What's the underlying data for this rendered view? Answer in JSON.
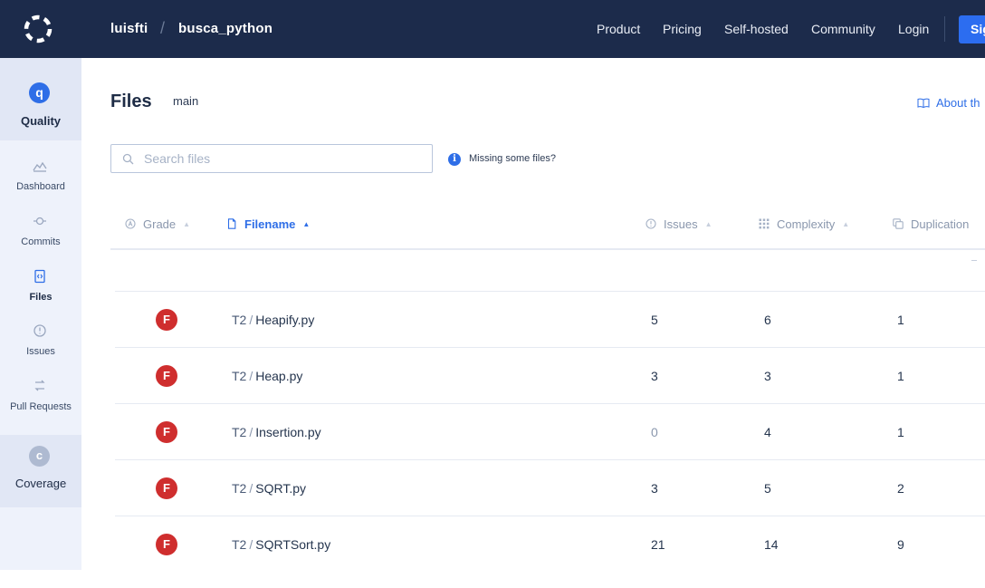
{
  "header": {
    "owner": "luisfti",
    "separator": "/",
    "repo": "busca_python",
    "nav": {
      "product": "Product",
      "pricing": "Pricing",
      "self_hosted": "Self-hosted",
      "community": "Community",
      "login": "Login"
    },
    "signup_label": "Sign"
  },
  "sidebar": {
    "quality": {
      "badge": "q",
      "label": "Quality"
    },
    "items": [
      {
        "label": "Dashboard",
        "icon": "dashboard-icon"
      },
      {
        "label": "Commits",
        "icon": "commits-icon"
      },
      {
        "label": "Files",
        "icon": "files-icon",
        "active": true
      },
      {
        "label": "Issues",
        "icon": "issues-icon"
      },
      {
        "label": "Pull Requests",
        "icon": "pull-requests-icon"
      }
    ],
    "coverage": {
      "badge": "c",
      "label": "Coverage"
    }
  },
  "main": {
    "title": "Files",
    "branch": "main",
    "about_link": "About th",
    "search": {
      "placeholder": "Search files",
      "value": ""
    },
    "missing_files_link": "Missing some files?",
    "columns": {
      "grade": "Grade",
      "filename": "Filename",
      "issues": "Issues",
      "complexity": "Complexity",
      "duplication": "Duplication"
    },
    "rows": [
      {
        "grade": "F",
        "dir": "T2",
        "file": "Heapify.py",
        "issues": "5",
        "complexity": "6",
        "duplication": "1"
      },
      {
        "grade": "F",
        "dir": "T2",
        "file": "Heap.py",
        "issues": "3",
        "complexity": "3",
        "duplication": "1"
      },
      {
        "grade": "F",
        "dir": "T2",
        "file": "Insertion.py",
        "issues": "0",
        "complexity": "4",
        "duplication": "1"
      },
      {
        "grade": "F",
        "dir": "T2",
        "file": "SQRT.py",
        "issues": "3",
        "complexity": "5",
        "duplication": "2"
      },
      {
        "grade": "F",
        "dir": "T2",
        "file": "SQRTSort.py",
        "issues": "21",
        "complexity": "14",
        "duplication": "9"
      }
    ]
  },
  "colors": {
    "topbar": "#1c2b4b",
    "accent": "#2e6ee7",
    "grade_f": "#cf2e2e",
    "sidebar_bg": "#eef2fb"
  }
}
